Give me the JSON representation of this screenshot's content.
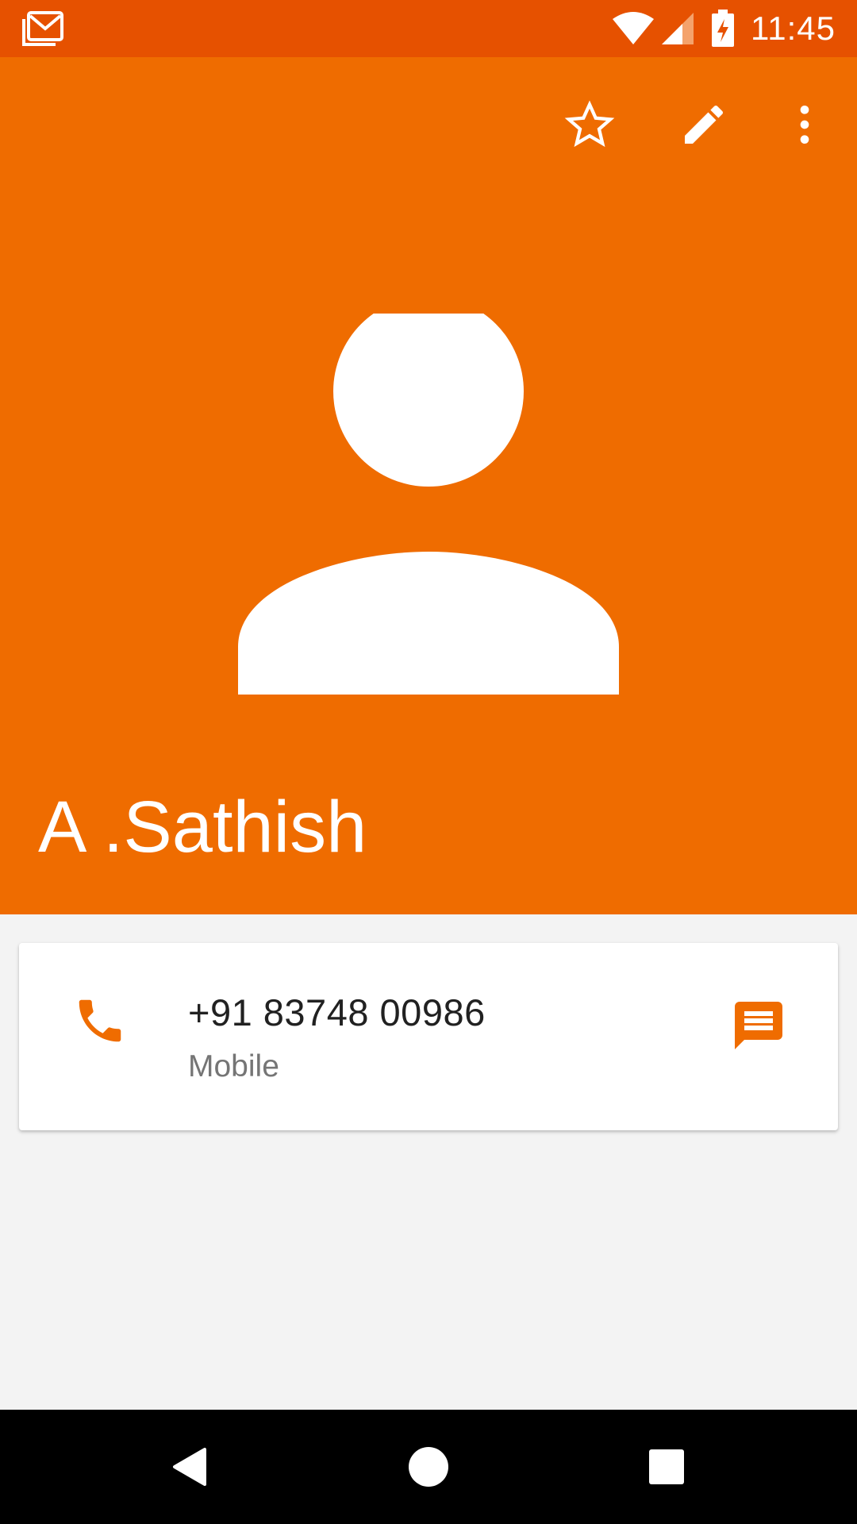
{
  "status_bar": {
    "time": "11:45",
    "notification_icon": "gmail-icon",
    "background_color": "#e65100"
  },
  "header": {
    "background_color": "#ef6c00",
    "actions": [
      "star-outline-icon",
      "edit-pencil-icon",
      "more-vert-icon"
    ],
    "avatar_icon": "person-placeholder-icon",
    "contact_name": "A .Sathish"
  },
  "phone_card": {
    "number": "+91 83748 00986",
    "type": "Mobile",
    "call_icon": "phone-icon",
    "message_icon": "message-icon",
    "accent_color": "#ef6c00"
  },
  "nav_bar": {
    "buttons": [
      "back-icon",
      "home-icon",
      "recents-icon"
    ]
  }
}
